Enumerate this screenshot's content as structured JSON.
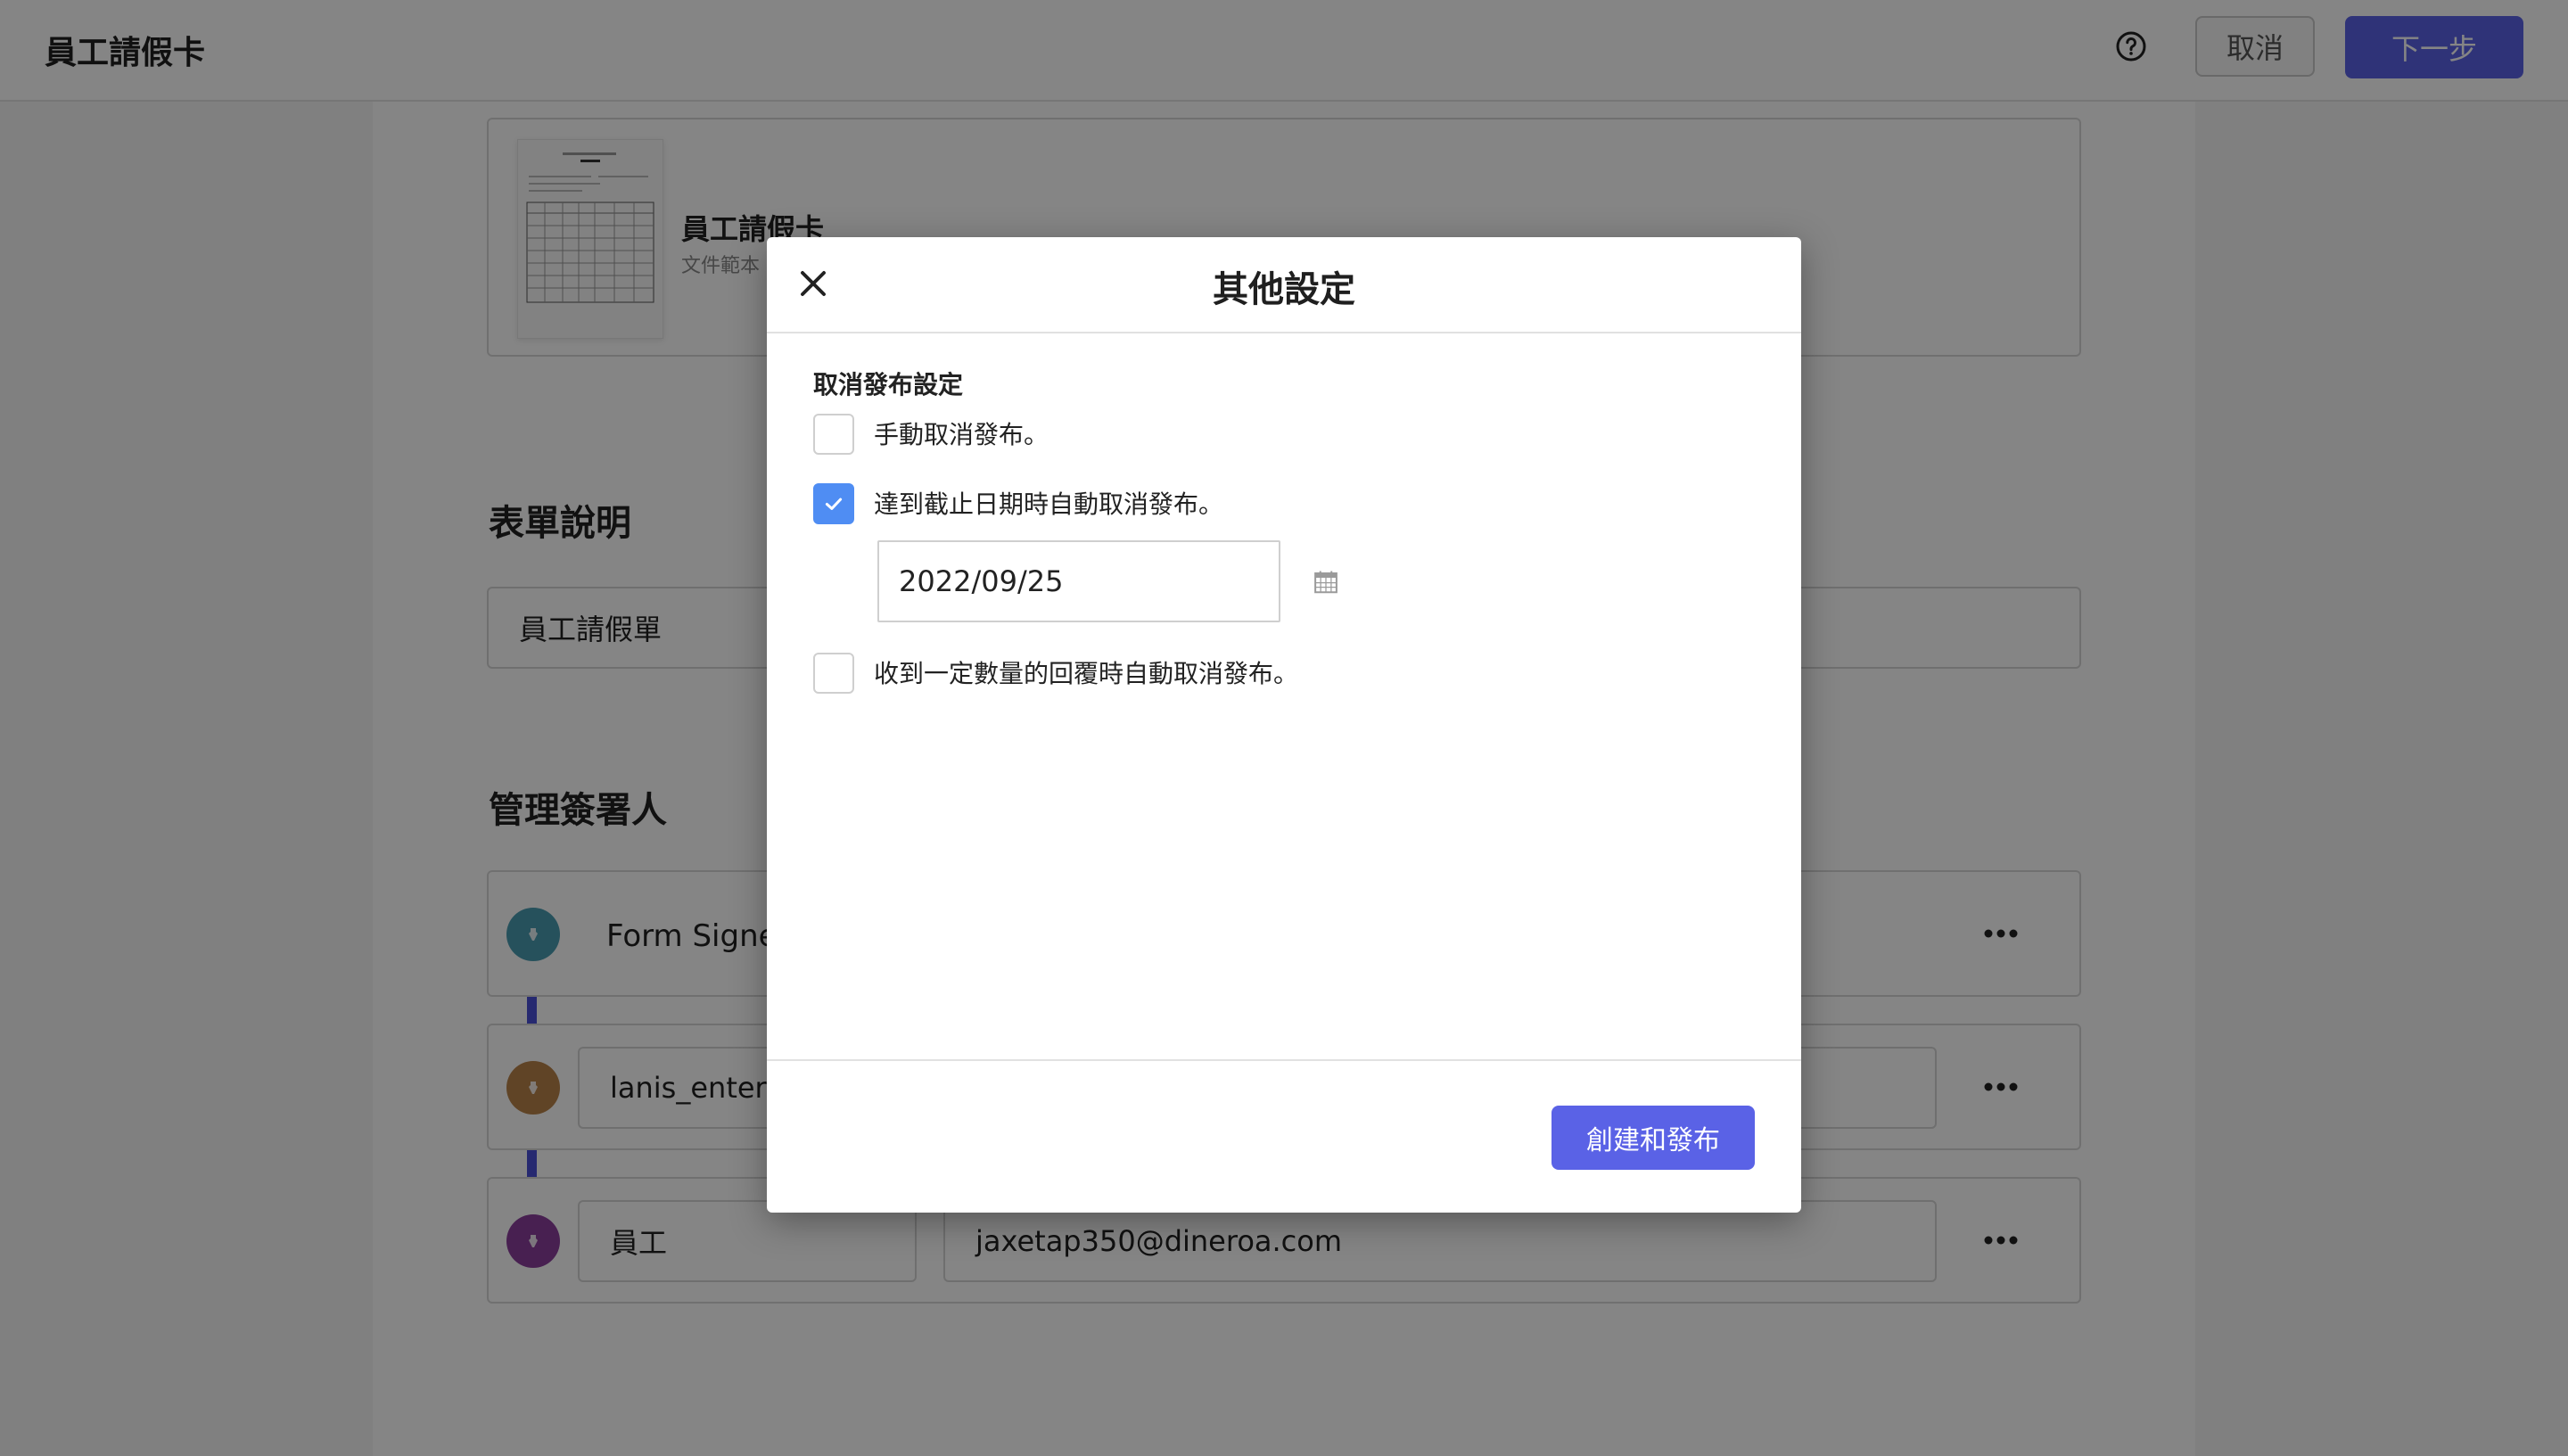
{
  "header": {
    "title": "員工請假卡",
    "help_icon": "help-circle-icon",
    "cancel_label": "取消",
    "next_label": "下一步"
  },
  "document": {
    "title": "員工請假卡",
    "subtitle": "文件範本"
  },
  "form_description": {
    "section_title": "表單說明",
    "value": "員工請假單"
  },
  "signers": {
    "section_title": "管理簽署人",
    "rows": [
      {
        "role": "Form Signer",
        "email": "",
        "color": "#4a9bb0"
      },
      {
        "role": "lanis_enterp",
        "email": "",
        "color": "#b9824a"
      },
      {
        "role": "員工",
        "email": "jaxetap350@dineroa.com",
        "color": "#8a3f9c"
      }
    ]
  },
  "modal": {
    "title": "其他設定",
    "section_label": "取消發布設定",
    "options": [
      {
        "label": "手動取消發布。",
        "checked": false
      },
      {
        "label": "達到截止日期時自動取消發布。",
        "checked": true
      },
      {
        "label": "收到一定數量的回覆時自動取消發布。",
        "checked": false
      }
    ],
    "deadline_date": "2022/09/25",
    "publish_label": "創建和發布"
  },
  "colors": {
    "primary": "#5a62e6",
    "checkbox_checked": "#4f8df3",
    "connector": "#4a50d6"
  }
}
